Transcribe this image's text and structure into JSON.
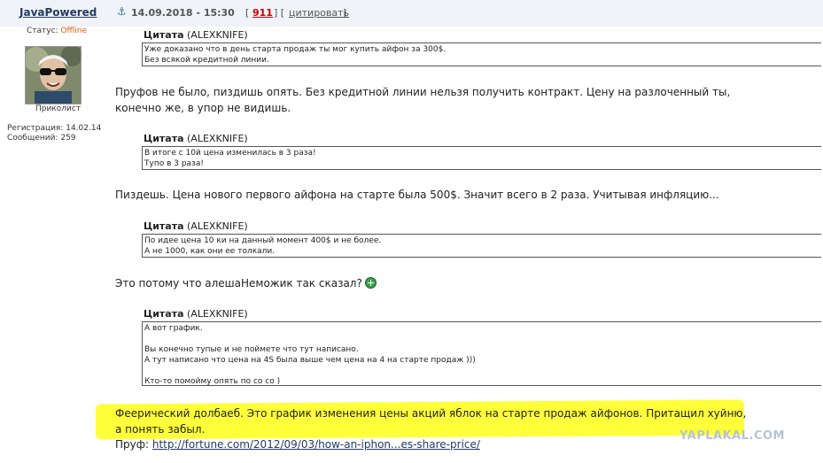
{
  "post": {
    "author": "JavaPowered",
    "anchor_icon": "anchor-icon",
    "datetime": "14.09.2018 - 15:30",
    "number": "911",
    "cite_label": "цитировать",
    "bracket_open": "[",
    "bracket_mid": "] [",
    "bracket_close": "]"
  },
  "user": {
    "status_label": "Статус:",
    "status_value": "Offline",
    "rank": "Приколист",
    "reg_label": "Регистрация: 14.02.14",
    "messages_label": "Сообщений: 259"
  },
  "quotes": [
    {
      "title": "Цитата",
      "author": "(ALEXKNIFE)",
      "lines": [
        "Уже доказано что в день старта продаж ты мог купить айфон за 300$.",
        "Без всякой кредитной линии."
      ]
    },
    {
      "title": "Цитата",
      "author": "(ALEXKNIFE)",
      "lines": [
        "В итоге с 10й цена изменилась в 3 раза!",
        "Тупо в 3 раза!"
      ]
    },
    {
      "title": "Цитата",
      "author": "(ALEXKNIFE)",
      "lines": [
        "По идее цена 10 ки на данный момент 400$ и не более.",
        "А не 1000, как они ее толкали."
      ]
    },
    {
      "title": "Цитата",
      "author": "(ALEXKNIFE)",
      "lines": [
        "А вот график.",
        "",
        "Вы конечно тупые и не поймете что тут написано.",
        "А тут написано что цена на 4S была выше чем цена на 4 на старте продаж )))",
        "",
        "Кто-то помойму опять по со со )"
      ]
    }
  ],
  "replies": {
    "r1": "Пруфов не было, пиздишь опять. Без кредитной линии нельзя получить контракт. Цену на разлоченный ты, конечно же, в упор не видишь.",
    "r2": "Пиздешь. Цена нового первого айфона на старте была 500$. Значит всего в 2 раза. Учитывая инфляцию...",
    "r3": "Это потому что алешаНеможик так сказал?",
    "r4": "Феерический долбаеб. Это график изменения цены акций яблок на старте продаж айфонов. Притащил хуйню, а понять забыл.",
    "proof_label": "Пруф:",
    "proof_link": "http://fortune.com/2012/09/03/how-an-iphon...es-share-price/"
  },
  "watermark": "YAPLAKAL.COM",
  "colors": {
    "highlight": "#ffff3a",
    "post_number": "#cc0000",
    "status_offline": "#e05a00"
  }
}
